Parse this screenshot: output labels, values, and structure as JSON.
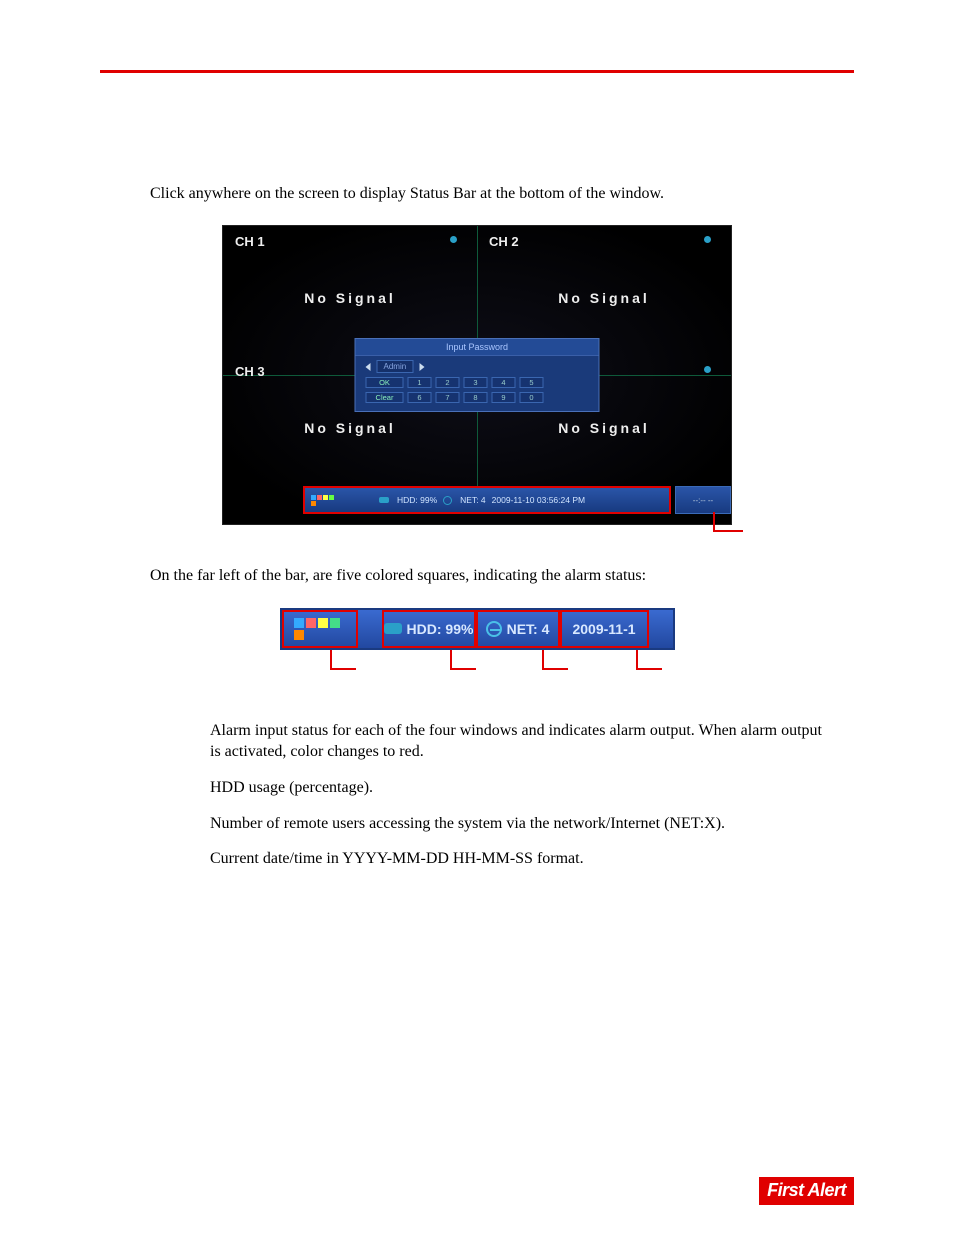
{
  "intro_text": "Click anywhere on the screen to display Status Bar at the bottom of the window.",
  "screen": {
    "channels": [
      "CH 1",
      "CH 2",
      "CH 3",
      ""
    ],
    "no_signal": "No Signal",
    "password_dialog": {
      "title": "Input Password",
      "user": "Admin",
      "ok": "OK",
      "clear": "Clear",
      "keys_row1": [
        "1",
        "2",
        "3",
        "4",
        "5"
      ],
      "keys_row2": [
        "6",
        "7",
        "8",
        "9",
        "0"
      ]
    },
    "statusbar": {
      "hdd_label": "HDD: 99%",
      "net_label": "NET: 4",
      "datetime": "2009-11-10 03:56:24 PM",
      "right": "--:-- --"
    }
  },
  "para2_text": "On the far left of the bar, are five colored squares, indicating the alarm status:",
  "statusbar_large": {
    "hdd_label": "HDD: 99%",
    "net_label": "NET: 4",
    "date_fragment": "2009-11-1"
  },
  "descriptions": [
    "Alarm input status for each of the four windows and indicates alarm output. When alarm output is activated, color changes to red.",
    "HDD usage (percentage).",
    "Number of remote users accessing the system via the network/Internet (NET:X).",
    "Current date/time in YYYY-MM-DD HH-MM-SS format."
  ],
  "logo_text": "First Alert"
}
